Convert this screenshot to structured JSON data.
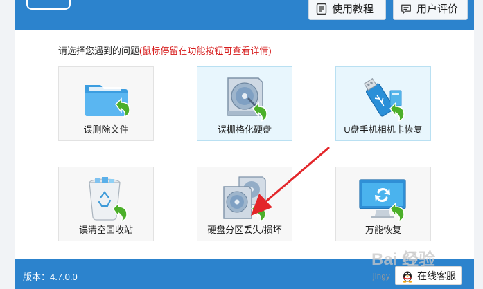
{
  "header": {
    "tutorial_label": "使用教程",
    "review_label": "用户评价"
  },
  "prompt": {
    "text": "请选择您遇到的问题",
    "hint": "(鼠标停留在功能按钮可查看详情)"
  },
  "tiles": [
    {
      "label": "误删除文件",
      "icon": "folder-recover-icon"
    },
    {
      "label": "误栅格化硬盘",
      "icon": "disk-recover-icon"
    },
    {
      "label": "U盘手机相机卡恢复",
      "icon": "usb-card-recover-icon"
    },
    {
      "label": "误清空回收站",
      "icon": "recycle-bin-recover-icon"
    },
    {
      "label": "硬盘分区丢失/损坏",
      "icon": "partition-recover-icon"
    },
    {
      "label": "万能恢复",
      "icon": "monitor-refresh-icon"
    }
  ],
  "footer": {
    "version": "版本：4.7.0.0",
    "support_label": "在线客服"
  },
  "watermark": {
    "logo": "Bai 经验",
    "url": "jingy"
  },
  "colors": {
    "header": "#2c83cd",
    "hint": "#d61a1a",
    "arrow": "#e3262a"
  }
}
